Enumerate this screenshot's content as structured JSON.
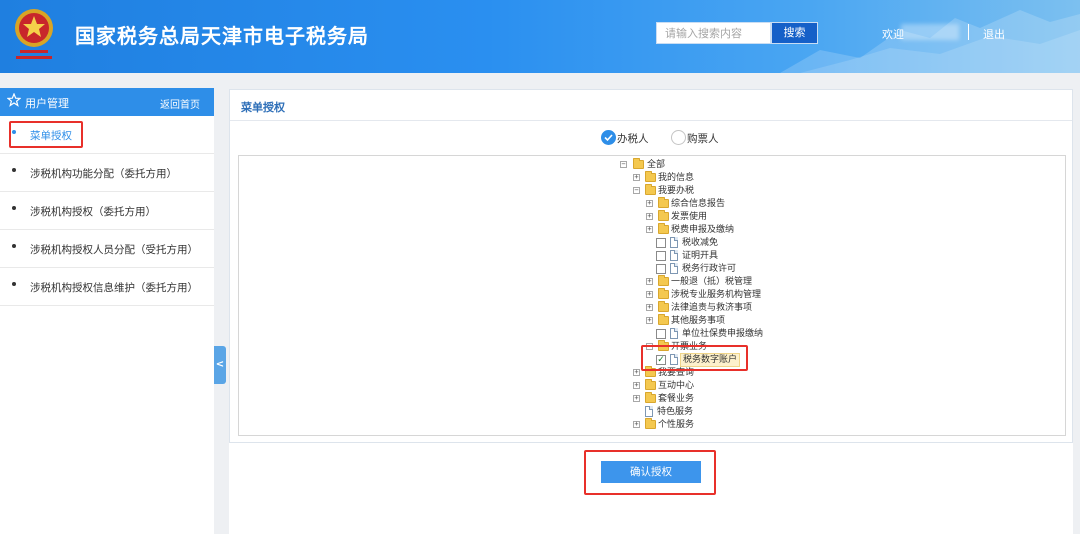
{
  "header": {
    "site_title": "国家税务总局天津市电子税务局",
    "search_placeholder": "请输入搜索内容",
    "search_button": "搜索",
    "welcome_prefix": "欢迎",
    "logout": "退出"
  },
  "sidebar": {
    "title": "用户管理",
    "back_link": "返回首页",
    "items": [
      {
        "label": "菜单授权",
        "active": true
      },
      {
        "label": "涉税机构功能分配（委托方用）",
        "active": false
      },
      {
        "label": "涉税机构授权（委托方用）",
        "active": false
      },
      {
        "label": "涉税机构授权人员分配（受托方用）",
        "active": false
      },
      {
        "label": "涉税机构授权信息维护（委托方用）",
        "active": false
      }
    ]
  },
  "panel": {
    "title": "菜单授权",
    "radios": [
      {
        "label": "办税人",
        "checked": true
      },
      {
        "label": "购票人",
        "checked": false
      }
    ]
  },
  "tree": [
    {
      "label": "全部",
      "kind": "folder",
      "toggle": "minus"
    },
    {
      "label": "我的信息",
      "kind": "folder",
      "toggle": "plus"
    },
    {
      "label": "我要办税",
      "kind": "folder",
      "toggle": "minus"
    },
    {
      "label": "综合信息报告",
      "kind": "folder",
      "toggle": "plus"
    },
    {
      "label": "发票使用",
      "kind": "folder",
      "toggle": "plus"
    },
    {
      "label": "税费申报及缴纳",
      "kind": "folder",
      "toggle": "plus"
    },
    {
      "label": "税收减免",
      "kind": "doc",
      "checkbox": true,
      "checked": false
    },
    {
      "label": "证明开具",
      "kind": "doc",
      "checkbox": true,
      "checked": false
    },
    {
      "label": "税务行政许可",
      "kind": "doc",
      "checkbox": true,
      "checked": false
    },
    {
      "label": "一般退（抵）税管理",
      "kind": "folder",
      "toggle": "plus"
    },
    {
      "label": "涉税专业服务机构管理",
      "kind": "folder",
      "toggle": "plus"
    },
    {
      "label": "法律追责与救济事项",
      "kind": "folder",
      "toggle": "plus"
    },
    {
      "label": "其他服务事项",
      "kind": "folder",
      "toggle": "plus"
    },
    {
      "label": "单位社保费申报缴纳",
      "kind": "doc",
      "checkbox": true,
      "checked": false
    },
    {
      "label": "开票业务",
      "kind": "folder",
      "toggle": "minus"
    },
    {
      "label": "税务数字账户",
      "kind": "doc",
      "checkbox": true,
      "checked": true,
      "selected": true
    },
    {
      "label": "我要查询",
      "kind": "folder",
      "toggle": "plus"
    },
    {
      "label": "互动中心",
      "kind": "folder",
      "toggle": "plus"
    },
    {
      "label": "套餐业务",
      "kind": "folder",
      "toggle": "plus"
    },
    {
      "label": "特色服务",
      "kind": "doc"
    },
    {
      "label": "个性服务",
      "kind": "folder",
      "toggle": "plus"
    }
  ],
  "confirm_button": "确认授权",
  "colors": {
    "header_blue": "#2a8ff0",
    "accent": "#2e8ee8",
    "confirm": "#3d95ec",
    "highlight": "#e8302a"
  }
}
